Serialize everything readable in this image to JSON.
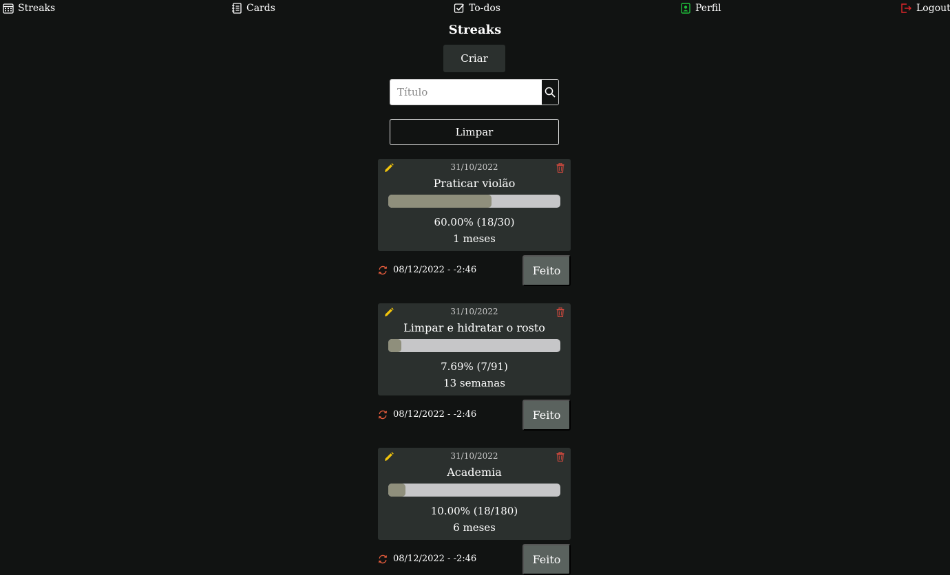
{
  "nav": {
    "streaks": "Streaks",
    "cards": "Cards",
    "todos": "To-dos",
    "perfil": "Perfil",
    "logout": "Logout"
  },
  "page": {
    "title": "Streaks",
    "create_label": "Criar",
    "search_placeholder": "Título",
    "clear_label": "Limpar"
  },
  "colors": {
    "background": "#111312",
    "card": "#2b302e",
    "progress_fill": "#8f8f7c",
    "progress_track": "#c6c6c8",
    "edit_icon": "#f2c40c",
    "trash_icon": "#c9483d",
    "reset_icon": "#e85d3d",
    "profile_icon": "#1fbf3a",
    "logout_icon": "#e0262a"
  },
  "streaks": [
    {
      "date": "31/10/2022",
      "title": "Praticar violão",
      "progress": 0.6,
      "percent_text": "60.00% (18/30)",
      "duration": "1 meses",
      "reset": "08/12/2022 - -2:46",
      "done_label": "Feito"
    },
    {
      "date": "31/10/2022",
      "title": "Limpar e hidratar o rosto",
      "progress": 0.0769,
      "percent_text": "7.69% (7/91)",
      "duration": "13 semanas",
      "reset": "08/12/2022 - -2:46",
      "done_label": "Feito"
    },
    {
      "date": "31/10/2022",
      "title": "Academia",
      "progress": 0.1,
      "percent_text": "10.00% (18/180)",
      "duration": "6 meses",
      "reset": "08/12/2022 - -2:46",
      "done_label": "Feito"
    }
  ]
}
